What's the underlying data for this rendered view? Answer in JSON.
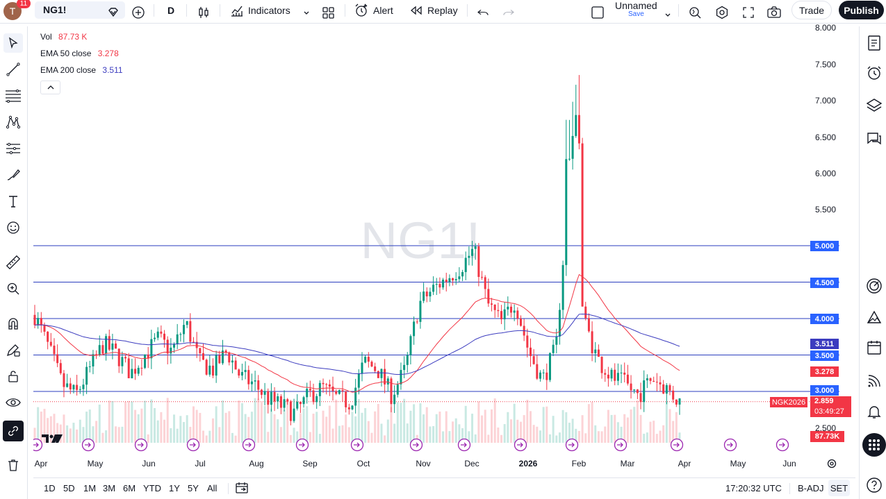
{
  "topbar": {
    "avatar_letter": "T",
    "notifications": "11",
    "symbol": "NG1!",
    "interval": "D",
    "indicators_label": "Indicators",
    "alert_label": "Alert",
    "replay_label": "Replay",
    "layout_name": "Unnamed",
    "layout_status": "Save",
    "trade_label": "Trade",
    "publish_label": "Publish"
  },
  "legend": {
    "vol_label": "Vol",
    "vol_value": "87.73 K",
    "ema50_label": "EMA 50 close",
    "ema50_value": "3.278",
    "ema200_label": "EMA 200 close",
    "ema200_value": "3.511"
  },
  "watermark": "NG1!",
  "price_axis": [
    "8.000",
    "7.500",
    "7.000",
    "6.500",
    "6.000",
    "5.500",
    "2.500"
  ],
  "hlines": [
    {
      "label": "5.000",
      "value": 5.0
    },
    {
      "label": "4.500",
      "value": 4.5
    },
    {
      "label": "4.000",
      "value": 4.0
    },
    {
      "label": "3.500",
      "value": 3.5
    },
    {
      "label": "3.000",
      "value": 3.0
    }
  ],
  "price_labels": {
    "ema200": "3.511",
    "ema50": "3.278",
    "symbol_tag": "NGK2026",
    "last_price": "2.859",
    "countdown": "03:49:27",
    "volume": "87.73K"
  },
  "time_axis": [
    "Apr",
    "May",
    "Jun",
    "Jul",
    "Aug",
    "Sep",
    "Oct",
    "Nov",
    "Dec",
    "2026",
    "Feb",
    "Mar",
    "Apr",
    "May",
    "Jun"
  ],
  "bottom": {
    "ranges": [
      "1D",
      "5D",
      "1M",
      "3M",
      "6M",
      "YTD",
      "1Y",
      "5Y",
      "All"
    ],
    "clock": "17:20:32 UTC",
    "badj": "B-ADJ",
    "set": "SET"
  },
  "colors": {
    "up": "#089981",
    "down": "#f23645",
    "ema50": "#f23645",
    "ema200": "#3c3cbf",
    "hline": "#2a3ebf",
    "label_blue": "#2962ff"
  },
  "chart_data": {
    "type": "candlestick",
    "symbol": "NG1!",
    "ylim": [
      2.4,
      8.0
    ],
    "hlines": [
      5.0,
      4.5,
      4.0,
      3.5,
      3.0
    ],
    "last_price": 2.859,
    "ema50_last": 3.278,
    "ema200_last": 3.511,
    "close_path": [
      {
        "m": "Apr",
        "c": 4.05
      },
      {
        "m": "Apr",
        "c": 3.6
      },
      {
        "m": "Apr",
        "c": 3.1
      },
      {
        "m": "Apr",
        "c": 2.95
      },
      {
        "m": "May",
        "c": 3.3
      },
      {
        "m": "May",
        "c": 3.65
      },
      {
        "m": "May",
        "c": 3.5
      },
      {
        "m": "May",
        "c": 3.25
      },
      {
        "m": "Jun",
        "c": 3.5
      },
      {
        "m": "Jun",
        "c": 3.72
      },
      {
        "m": "Jun",
        "c": 3.55
      },
      {
        "m": "Jun",
        "c": 3.95
      },
      {
        "m": "Jul",
        "c": 3.4
      },
      {
        "m": "Jul",
        "c": 3.3
      },
      {
        "m": "Jul",
        "c": 3.55
      },
      {
        "m": "Jul",
        "c": 3.2
      },
      {
        "m": "Aug",
        "c": 3.1
      },
      {
        "m": "Aug",
        "c": 2.9
      },
      {
        "m": "Aug",
        "c": 2.8
      },
      {
        "m": "Aug",
        "c": 2.7
      },
      {
        "m": "Sep",
        "c": 2.95
      },
      {
        "m": "Sep",
        "c": 3.05
      },
      {
        "m": "Sep",
        "c": 2.9
      },
      {
        "m": "Sep",
        "c": 2.85
      },
      {
        "m": "Oct",
        "c": 3.4
      },
      {
        "m": "Oct",
        "c": 3.3
      },
      {
        "m": "Oct",
        "c": 2.95
      },
      {
        "m": "Oct",
        "c": 3.3
      },
      {
        "m": "Nov",
        "c": 4.2
      },
      {
        "m": "Nov",
        "c": 4.4
      },
      {
        "m": "Nov",
        "c": 4.55
      },
      {
        "m": "Nov",
        "c": 4.7
      },
      {
        "m": "Dec",
        "c": 4.95
      },
      {
        "m": "Dec",
        "c": 4.2
      },
      {
        "m": "Dec",
        "c": 3.95
      },
      {
        "m": "Dec",
        "c": 4.25
      },
      {
        "m": "2026",
        "c": 3.55
      },
      {
        "m": "2026",
        "c": 3.15
      },
      {
        "m": "2026",
        "c": 3.6
      },
      {
        "m": "2026",
        "c": 6.0
      },
      {
        "m": "Feb",
        "c": 4.0
      },
      {
        "m": "Feb",
        "c": 3.45
      },
      {
        "m": "Feb",
        "c": 3.2
      },
      {
        "m": "Feb",
        "c": 3.1
      },
      {
        "m": "Mar",
        "c": 2.95
      },
      {
        "m": "Mar",
        "c": 3.2
      },
      {
        "m": "Mar",
        "c": 3.05
      },
      {
        "m": "Mar",
        "c": 2.86
      }
    ]
  }
}
